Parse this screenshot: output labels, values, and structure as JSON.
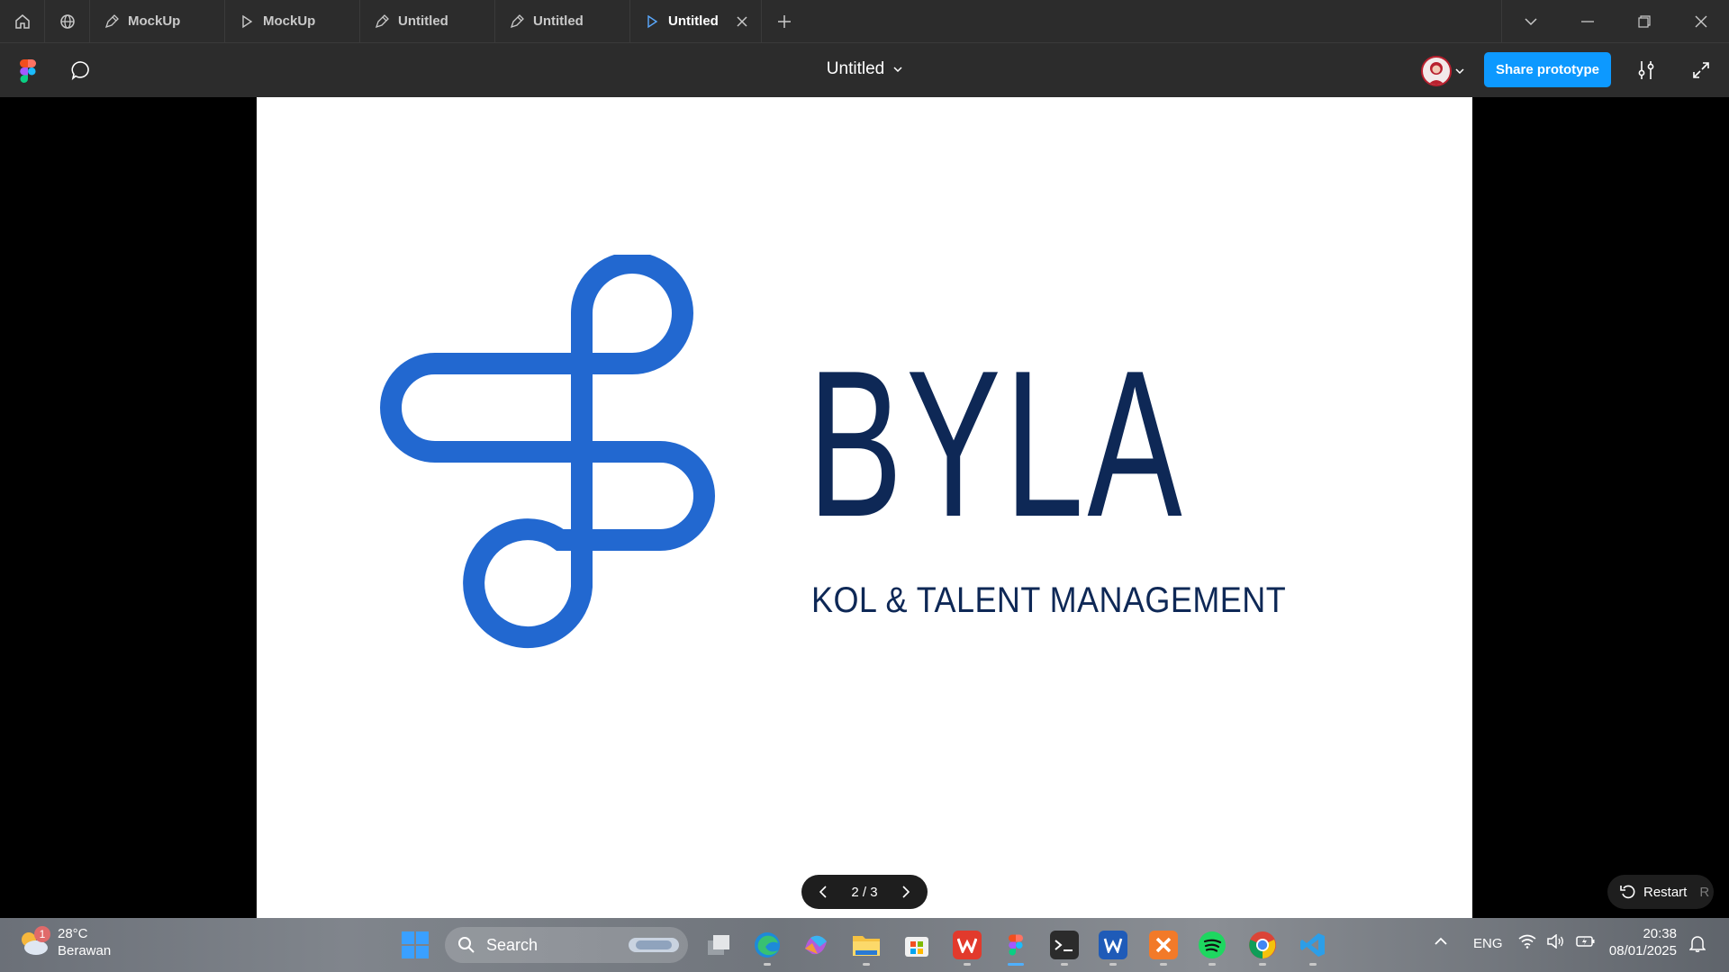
{
  "tabs": [
    {
      "label": "MockUp",
      "icon": "pen-icon"
    },
    {
      "label": "MockUp",
      "icon": "play-icon"
    },
    {
      "label": "Untitled",
      "icon": "pen-icon"
    },
    {
      "label": "Untitled",
      "icon": "pen-icon"
    },
    {
      "label": "Untitled",
      "icon": "play-icon",
      "active": true
    }
  ],
  "toolbar": {
    "doc_title": "Untitled",
    "share_label": "Share prototype"
  },
  "slide": {
    "brand": "BYLA",
    "tagline": "KOL & TALENT MANAGEMENT",
    "brand_color": "#0e2856",
    "mark_color": "#2268d0"
  },
  "pager": {
    "label": "2 / 3",
    "current": 2,
    "total": 3
  },
  "restart": {
    "label": "Restart",
    "shortcut": "R"
  },
  "taskbar": {
    "weather_badge": "1",
    "temperature": "28°C",
    "condition": "Berawan",
    "search_label": "Search",
    "language": "ENG",
    "time": "20:38",
    "date": "08/01/2025"
  },
  "colors": {
    "accent": "#0d99ff",
    "toolbar_bg": "#2c2c2c"
  }
}
